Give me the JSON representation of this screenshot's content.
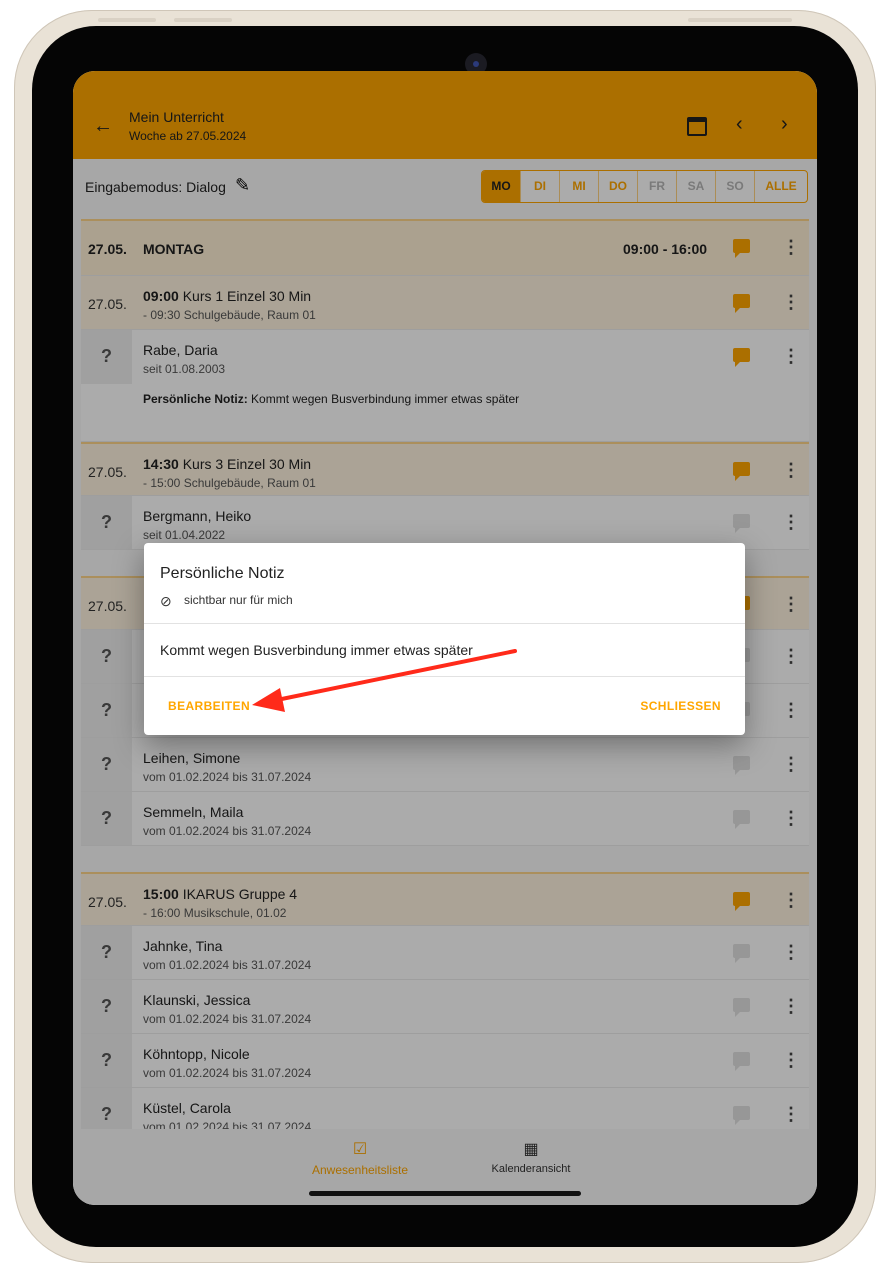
{
  "appbar": {
    "back_icon": "arrow-left-icon",
    "title": "Mein Unterricht",
    "subtitle": "Woche ab 27.05.2024",
    "calendar_icon": "calendar-icon",
    "prev_icon": "chevron-left-icon",
    "next_icon": "chevron-right-icon"
  },
  "toolbar": {
    "mode_label": "Eingabemodus: Dialog",
    "days": [
      "MO",
      "DI",
      "MI",
      "DO",
      "FR",
      "SA",
      "SO",
      "ALLE"
    ],
    "selected_day": "MO"
  },
  "list": {
    "day_header": {
      "date": "27.05.",
      "weekday": "MONTAG",
      "time": "09:00 - 16:00"
    },
    "lesson1": {
      "date": "27.05.",
      "time": "09:00",
      "title": "Kurs 1 Einzel 30 Min",
      "detail": "- 09:30 Schulgebäude, Raum 01"
    },
    "student1": {
      "status": "?",
      "name": "Rabe, Daria",
      "since": "seit 01.08.2003",
      "note_label": "Persönliche Notiz:",
      "note_text": "Kommt wegen Busverbindung immer etwas später"
    },
    "lesson2": {
      "date": "27.05.",
      "time": "14:30",
      "title": "Kurs 3 Einzel 30 Min",
      "detail": "- 15:00 Schulgebäude, Raum 01"
    },
    "student2": {
      "status": "?",
      "name": "Bergmann, Heiko",
      "since": "seit 01.04.2022"
    },
    "lesson3": {
      "date": "27.05."
    },
    "student3": {
      "status": "?"
    },
    "student4": {
      "status": "?"
    },
    "student5": {
      "status": "?",
      "name": "Leihen, Simone",
      "since": "vom 01.02.2024 bis 31.07.2024"
    },
    "student6": {
      "status": "?",
      "name": "Semmeln, Maila",
      "since": "vom 01.02.2024 bis 31.07.2024"
    },
    "lesson4": {
      "date": "27.05.",
      "time": "15:00",
      "title": "IKARUS Gruppe 4",
      "detail": "- 16:00 Musikschule, 01.02"
    },
    "student7": {
      "status": "?",
      "name": "Jahnke, Tina",
      "since": "vom 01.02.2024 bis 31.07.2024"
    },
    "student8": {
      "status": "?",
      "name": "Klaunski, Jessica",
      "since": "vom 01.02.2024 bis 31.07.2024"
    },
    "student9": {
      "status": "?",
      "name": "Köhntopp, Nicole",
      "since": "vom 01.02.2024 bis 31.07.2024"
    },
    "student10": {
      "status": "?",
      "name": "Küstel, Carola",
      "since": "vom 01.02.2024 bis 31.07.2024"
    }
  },
  "bottomnav": {
    "attendance_label": "Anwesenheitsliste",
    "calendar_label": "Kalenderansicht"
  },
  "dialog": {
    "title": "Persönliche Notiz",
    "visibility": "sichtbar nur für mich",
    "content": "Kommt wegen Busverbindung immer etwas später",
    "edit_label": "BEARBEITEN",
    "close_label": "SCHLIESSEN"
  },
  "colors": {
    "accent": "#ffa600",
    "arrow": "#ff2a1a"
  }
}
